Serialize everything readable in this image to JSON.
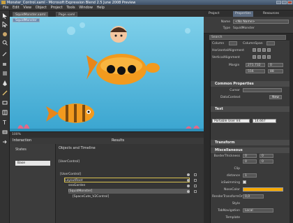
{
  "window": {
    "title": "Monster_Control.xaml - Microsoft Expression Blend 2.5 June 2008 Preview"
  },
  "menu": [
    "File",
    "Edit",
    "View",
    "Object",
    "Project",
    "Tools",
    "Window",
    "Help"
  ],
  "doc_tabs": [
    "SquidMonster.xaml",
    "Page.xaml"
  ],
  "artboard": {
    "breadcrumb": "SquidMonster"
  },
  "status": {
    "zoom": "100%"
  },
  "interaction": {
    "title": "Interaction",
    "results": "Results"
  },
  "states": {
    "title": "States",
    "base": "Base"
  },
  "objects": {
    "title": "Objects and Timeline",
    "header_item": "[UserControl]",
    "tree": [
      "[UserControl]",
      "LayoutRoot",
      "seaGarden",
      "[SquidMonster]",
      "[SpaceCute_V2Control]"
    ]
  },
  "right_tabs": [
    "Project",
    "Properties",
    "Resources"
  ],
  "props": {
    "name_label": "Name",
    "name_value": "<No Name>",
    "type_label": "Type",
    "type_value": "SquidMonster",
    "search": "Search",
    "layout": {
      "column": "Column",
      "columnspan": "ColumnSpan",
      "halign": "HorizontalAlignment",
      "valign": "VerticalAlignment",
      "margin": "Margin",
      "m1": "271.732",
      "m2": "0",
      "m3": "556",
      "m4": "88"
    },
    "common": {
      "title": "Common Properties",
      "cursor": "Cursor",
      "datacontext": "DataContext",
      "new": "New"
    },
    "text": {
      "title": "Text",
      "font": "Portable User Int",
      "size": "14.667"
    },
    "transform": {
      "title": "Transform"
    },
    "misc": {
      "title": "Miscellaneous",
      "border": "BorderThickness",
      "clip": "Clip",
      "distance": "distance",
      "isSwimming": "isSwimming",
      "nosecolor": "NoseColor",
      "rto": "RenderTransformOri...",
      "rto_value": "0,0",
      "style": "Style",
      "tabnav": "TabNavigation",
      "tabnav_value": "Local",
      "template": "Template",
      "bt1": "0",
      "bt2": "0",
      "bt3": "0",
      "bt4": "0",
      "dist": "1"
    },
    "colors": {
      "nose": "#f5a800",
      "accent": "#4a90d9"
    }
  }
}
